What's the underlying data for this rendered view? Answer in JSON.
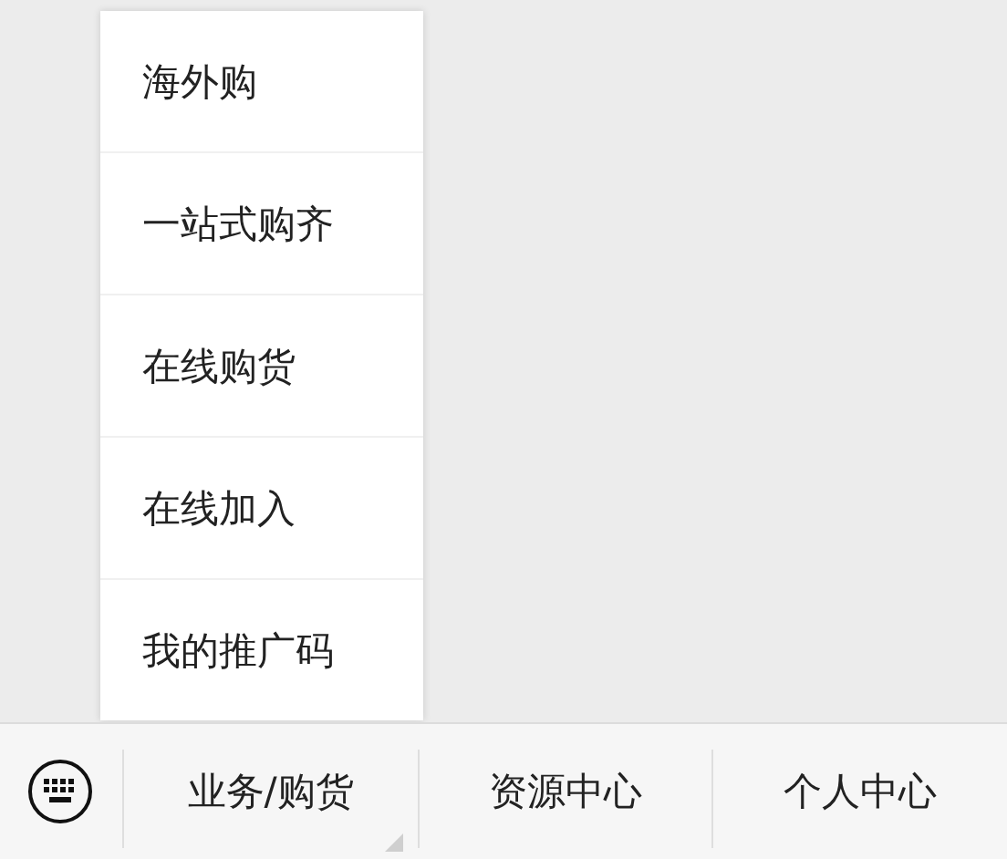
{
  "menu_bar": {
    "tabs": [
      {
        "label": "业务/购货",
        "has_submenu": true,
        "submenu": [
          "海外购",
          "一站式购齐",
          "在线购货",
          "在线加入",
          "我的推广码"
        ]
      },
      {
        "label": "资源中心",
        "has_submenu": false
      },
      {
        "label": "个人中心",
        "has_submenu": false
      }
    ]
  }
}
